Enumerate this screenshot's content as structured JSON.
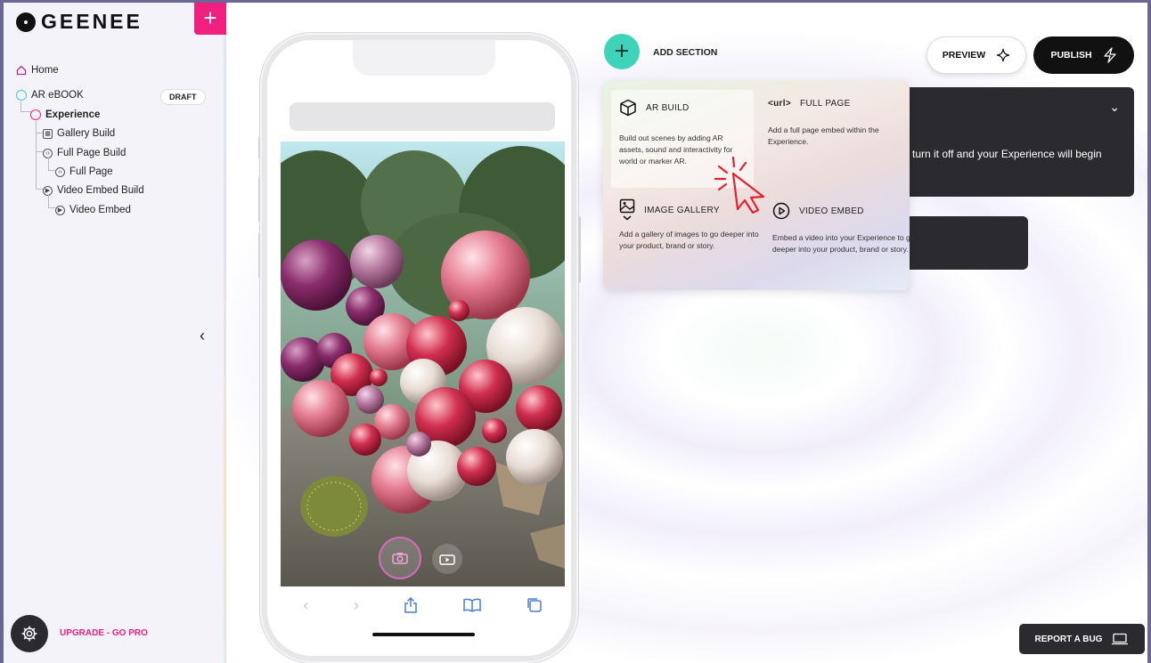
{
  "brand": {
    "name": "GEENEE",
    "accent": "#f0217e"
  },
  "sidebar": {
    "new_button": "+",
    "tree": {
      "home": "Home",
      "project": "AR eBOOK",
      "project_badge": "DRAFT",
      "experience": "Experience",
      "gallery_build": "Gallery Build",
      "full_page_build": "Full Page Build",
      "full_page": "Full Page",
      "video_embed_build": "Video Embed Build",
      "video_embed": "Video Embed"
    },
    "collapse_icon": "chevron-left-icon",
    "upgrade": "UPGRADE - GO PRO"
  },
  "header": {
    "add_section": "ADD SECTION",
    "preview": "PREVIEW",
    "publish": "PUBLISH"
  },
  "section_menu": {
    "options": [
      {
        "title": "AR BUILD",
        "desc": "Build out scenes by adding AR assets, sound and interactivity for world or marker AR.",
        "icon": "cube-icon"
      },
      {
        "title": "FULL PAGE",
        "desc": "Add a full page embed within the Experience.",
        "icon": "url-icon",
        "icon_text": "<url>"
      },
      {
        "title": "IMAGE GALLERY",
        "desc": "Add a gallery of images to go deeper into your product, brand or story.",
        "icon": "image-icon"
      },
      {
        "title": "VIDEO EMBED",
        "desc": "Embed a video into your Experience to go deeper into your product, brand or story.",
        "icon": "play-circle-icon"
      }
    ]
  },
  "panel": {
    "text": "turn it off and your Experience will begin"
  },
  "footer": {
    "report_bug": "REPORT A BUG"
  }
}
